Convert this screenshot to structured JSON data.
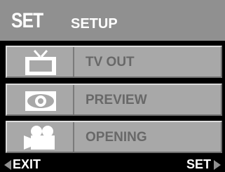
{
  "header": {
    "badge": "SET",
    "title": "SETUP"
  },
  "menu": {
    "items": [
      {
        "label": "TV OUT",
        "icon": "tv-icon"
      },
      {
        "label": "PREVIEW",
        "icon": "eye-preview-icon"
      },
      {
        "label": "OPENING",
        "icon": "movie-camera-icon"
      }
    ]
  },
  "footer": {
    "left_label": "EXIT",
    "right_label": "SET"
  },
  "colors": {
    "header_bg": "#909090",
    "row_bg": "#a8a8a8",
    "label_text": "#686868",
    "footer_bg": "#000000"
  }
}
